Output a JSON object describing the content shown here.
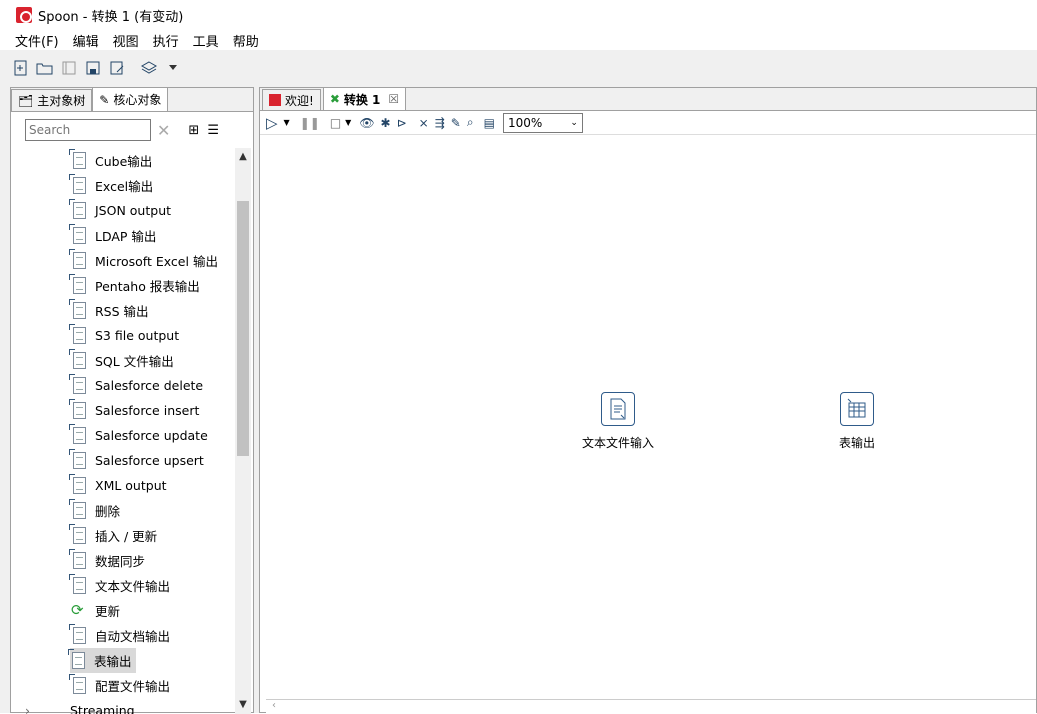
{
  "window": {
    "title": "Spoon - 转换 1 (有变动)"
  },
  "menu": [
    "文件(F)",
    "编辑",
    "视图",
    "执行",
    "工具",
    "帮助"
  ],
  "left_tabs": [
    "主对象树",
    "核心对象"
  ],
  "search": {
    "placeholder": "Search"
  },
  "tree_items": [
    "Cube输出",
    "Excel输出",
    "JSON output",
    "LDAP 输出",
    "Microsoft Excel 输出",
    "Pentaho 报表输出",
    "RSS 输出",
    "S3 file output",
    "SQL 文件输出",
    "Salesforce delete",
    "Salesforce insert",
    "Salesforce update",
    "Salesforce upsert",
    "XML output",
    "删除",
    "插入 / 更新",
    "数据同步",
    "文本文件输出",
    "更新",
    "自动文档输出",
    "表输出",
    "配置文件输出"
  ],
  "tree_category": "Streaming",
  "selected_item": "表输出",
  "editor_tabs": [
    {
      "label": "欢迎!"
    },
    {
      "label": "转换 1",
      "active": true
    }
  ],
  "zoom": "100%",
  "steps": [
    {
      "label": "文本文件输入"
    },
    {
      "label": "表输出"
    }
  ]
}
